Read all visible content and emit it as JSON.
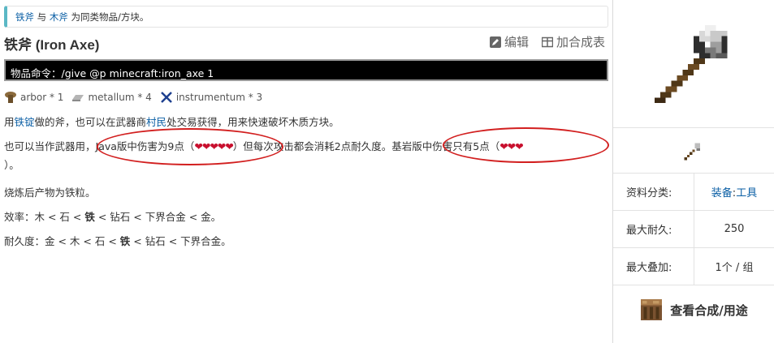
{
  "notice": {
    "item1": "铁斧",
    "conj": " 与 ",
    "item2": "木斧",
    "suffix": " 为同类物品/方块。"
  },
  "title": "铁斧 (Iron Axe)",
  "actions": {
    "edit": "编辑",
    "add_table": "加合成表"
  },
  "command": "物品命令：/give @p minecraft:iron_axe 1",
  "tags": [
    {
      "label": "arbor * 1",
      "icon": "log-icon"
    },
    {
      "label": "metallum * 4",
      "icon": "ingot-icon"
    },
    {
      "label": "instrumentum * 3",
      "icon": "tools-icon"
    }
  ],
  "p1": {
    "a": "用",
    "link1": "铁锭",
    "b": "做的斧，也可以在武器商",
    "link2": "村民",
    "c": "处交易获得，用来快速破坏木质方块。"
  },
  "p2": {
    "a": "也可以当作武器用，",
    "java": "Java版中伤害为9点（",
    "java_hearts": "❤❤❤❤❤",
    "java_close": "）",
    "b": "但每次攻击都会消耗2点耐久度。",
    "bedrock": "基岩版中伤害只有5点（",
    "bedrock_hearts": "❤❤❤",
    "bedrock_close": "）。"
  },
  "p3": "烧炼后产物为铁粒。",
  "p4": {
    "label": "效率：",
    "a": "木 < 石 < ",
    "bold": "铁",
    "b": " < 钻石 < 下界合金 < 金。"
  },
  "p5": {
    "label": "耐久度：",
    "a": "金 < 木 < 石 < ",
    "bold": "铁",
    "b": " < 钻石 < 下界合金。"
  },
  "infobox": {
    "rows": [
      {
        "key": "资料分类:",
        "value_link1": "装备",
        "sep": ":",
        "value_link2": "工具"
      },
      {
        "key": "最大耐久:",
        "value": "250"
      },
      {
        "key": "最大叠加:",
        "value": "1个 / 组"
      }
    ],
    "recipe": "查看合成/用途"
  }
}
